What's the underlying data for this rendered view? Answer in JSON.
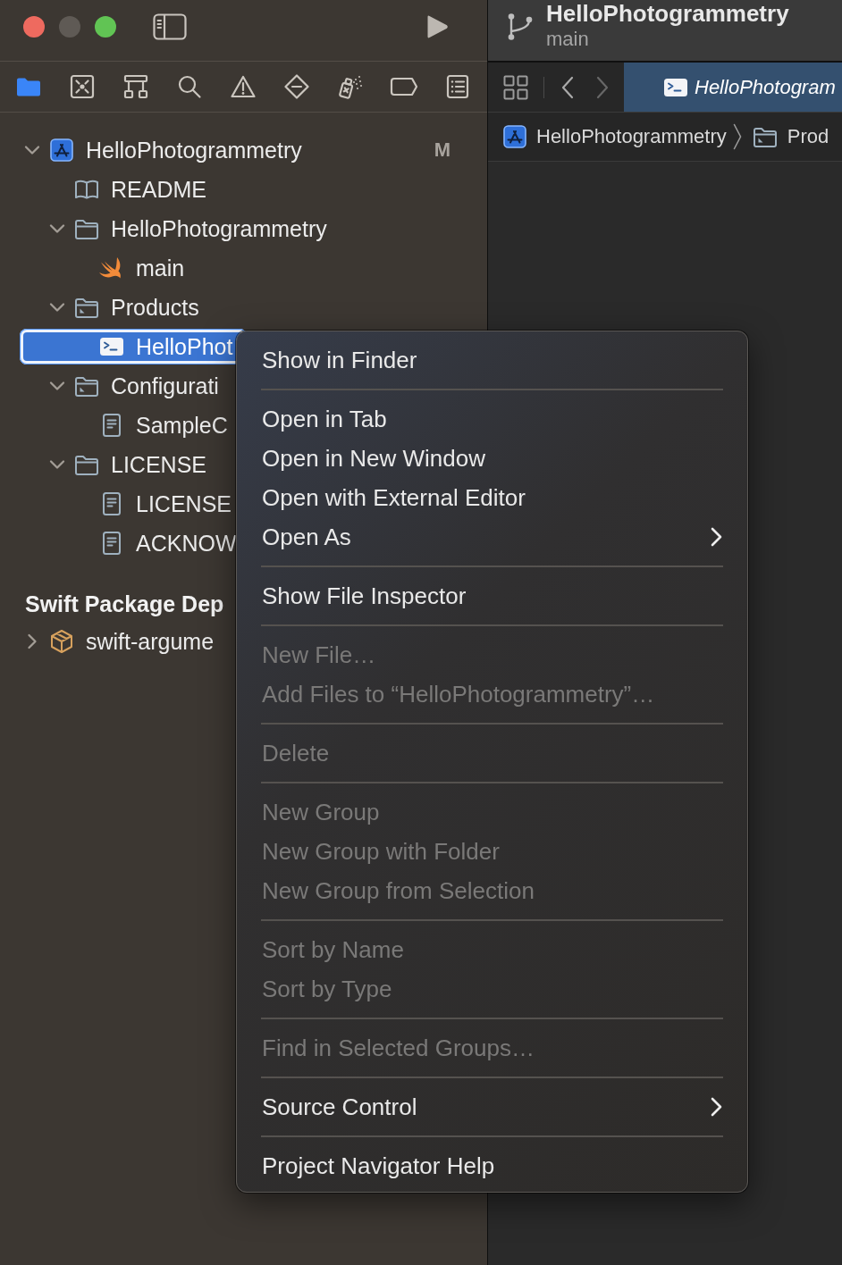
{
  "window": {
    "controls": [
      {
        "kind": "close",
        "disabled": false
      },
      {
        "kind": "minimize",
        "disabled": true
      },
      {
        "kind": "zoom",
        "disabled": false
      }
    ]
  },
  "navigator": {
    "tabs": [
      {
        "kind": "project",
        "selected": true
      },
      {
        "kind": "source-control",
        "selected": false
      },
      {
        "kind": "symbols",
        "selected": false
      },
      {
        "kind": "find",
        "selected": false
      },
      {
        "kind": "issues",
        "selected": false
      },
      {
        "kind": "tests",
        "selected": false
      },
      {
        "kind": "debug",
        "selected": false
      },
      {
        "kind": "breakpoints",
        "selected": false
      },
      {
        "kind": "reports",
        "selected": false
      }
    ],
    "tree": [
      {
        "label": "HelloPhotogrammetry",
        "kind": "project",
        "status": "M",
        "expanded": true,
        "selected": false,
        "children": [
          {
            "label": "README",
            "kind": "book",
            "selected": false
          },
          {
            "label": "HelloPhotogrammetry",
            "kind": "folder",
            "expanded": true,
            "selected": false,
            "children": [
              {
                "label": "main",
                "kind": "swift",
                "selected": false
              }
            ]
          },
          {
            "label": "Products",
            "kind": "marked-folder",
            "expanded": true,
            "selected": false,
            "children": [
              {
                "label": "HelloPhot",
                "kind": "executable",
                "selected": true
              }
            ]
          },
          {
            "label": "Configurati",
            "kind": "marked-folder",
            "expanded": true,
            "selected": false,
            "children": [
              {
                "label": "SampleC",
                "kind": "document",
                "selected": false
              }
            ]
          },
          {
            "label": "LICENSE",
            "kind": "folder",
            "expanded": true,
            "selected": false,
            "children": [
              {
                "label": "LICENSE",
                "kind": "document",
                "selected": false
              },
              {
                "label": "ACKNOW",
                "kind": "document",
                "selected": false
              }
            ]
          }
        ]
      }
    ],
    "sections": [
      {
        "title": "Swift Package Dep",
        "items": [
          {
            "label": "swift-argume",
            "kind": "package",
            "expanded": false,
            "selected": false
          }
        ]
      }
    ]
  },
  "toolbar": {
    "title": "HelloPhotogrammetry",
    "branch": "main"
  },
  "editor": {
    "back": {
      "disabled": false
    },
    "forward": {
      "disabled": true
    },
    "tabs": [
      {
        "label": "HelloPhotogram",
        "kind": "executable",
        "selected": true,
        "preview": true
      }
    ],
    "breadcrumbs": [
      {
        "label": "HelloPhotogrammetry",
        "kind": "project"
      },
      {
        "label": "Prod",
        "kind": "marked-folder"
      }
    ]
  },
  "context_menu": {
    "groups": [
      {
        "items": [
          {
            "label": "Show in Finder",
            "disabled": false,
            "submenu": false
          }
        ]
      },
      {
        "items": [
          {
            "label": "Open in Tab",
            "disabled": false,
            "submenu": false
          },
          {
            "label": "Open in New Window",
            "disabled": false,
            "submenu": false
          },
          {
            "label": "Open with External Editor",
            "disabled": false,
            "submenu": false
          },
          {
            "label": "Open As",
            "disabled": false,
            "submenu": true
          }
        ]
      },
      {
        "items": [
          {
            "label": "Show File Inspector",
            "disabled": false,
            "submenu": false
          }
        ]
      },
      {
        "items": [
          {
            "label": "New File…",
            "disabled": true,
            "submenu": false
          },
          {
            "label": "Add Files to “HelloPhotogrammetry”…",
            "disabled": true,
            "submenu": false
          }
        ]
      },
      {
        "items": [
          {
            "label": "Delete",
            "disabled": true,
            "submenu": false
          }
        ]
      },
      {
        "items": [
          {
            "label": "New Group",
            "disabled": true,
            "submenu": false
          },
          {
            "label": "New Group with Folder",
            "disabled": true,
            "submenu": false
          },
          {
            "label": "New Group from Selection",
            "disabled": true,
            "submenu": false
          }
        ]
      },
      {
        "items": [
          {
            "label": "Sort by Name",
            "disabled": true,
            "submenu": false
          },
          {
            "label": "Sort by Type",
            "disabled": true,
            "submenu": false
          }
        ]
      },
      {
        "items": [
          {
            "label": "Find in Selected Groups…",
            "disabled": true,
            "submenu": false
          }
        ]
      },
      {
        "items": [
          {
            "label": "Source Control",
            "disabled": false,
            "submenu": true
          }
        ]
      },
      {
        "items": [
          {
            "label": "Project Navigator Help",
            "disabled": false,
            "submenu": false
          }
        ]
      }
    ]
  }
}
